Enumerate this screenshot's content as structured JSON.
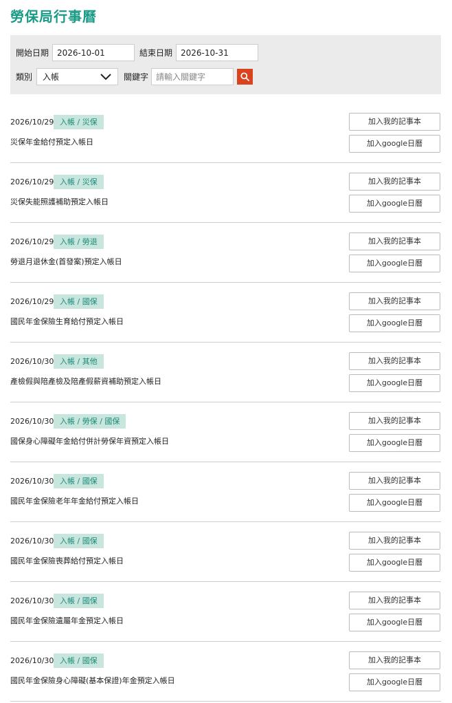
{
  "page": {
    "title": "勞保局行事曆"
  },
  "filters": {
    "start_date_label": "開始日期",
    "start_date_value": "2026-10-01",
    "end_date_label": "結束日期",
    "end_date_value": "2026-10-31",
    "category_label": "類別",
    "category_value": "入帳",
    "keyword_label": "關鍵字",
    "keyword_placeholder": "請輸入關鍵字",
    "search_icon": "search-icon",
    "search_button_color": "#d9441f"
  },
  "buttons": {
    "add_notebook": "加入我的記事本",
    "add_google": "加入google日曆"
  },
  "colors": {
    "title": "#1a9b87",
    "tag_background": "#c8e6de",
    "tag_text": "#1a8a78"
  },
  "events": [
    {
      "date": "2026/10/29",
      "tag": "入帳 / 災保",
      "title": "災保年金給付預定入帳日"
    },
    {
      "date": "2026/10/29",
      "tag": "入帳 / 災保",
      "title": "災保失能照護補助預定入帳日"
    },
    {
      "date": "2026/10/29",
      "tag": "入帳 / 勞退",
      "title": "勞退月退休金(首發案)預定入帳日"
    },
    {
      "date": "2026/10/29",
      "tag": "入帳 / 國保",
      "title": "國民年金保險生育給付預定入帳日"
    },
    {
      "date": "2026/10/30",
      "tag": "入帳 / 其他",
      "title": "產檢假與陪產檢及陪產假薪資補助預定入帳日"
    },
    {
      "date": "2026/10/30",
      "tag": "入帳 / 勞保 / 國保",
      "title": "國保身心障礙年金給付併計勞保年資預定入帳日"
    },
    {
      "date": "2026/10/30",
      "tag": "入帳 / 國保",
      "title": "國民年金保險老年年金給付預定入帳日"
    },
    {
      "date": "2026/10/30",
      "tag": "入帳 / 國保",
      "title": "國民年金保險喪葬給付預定入帳日"
    },
    {
      "date": "2026/10/30",
      "tag": "入帳 / 國保",
      "title": "國民年金保險遺屬年金預定入帳日"
    },
    {
      "date": "2026/10/30",
      "tag": "入帳 / 國保",
      "title": "國民年金保險身心障礙(基本保證)年金預定入帳日"
    }
  ]
}
